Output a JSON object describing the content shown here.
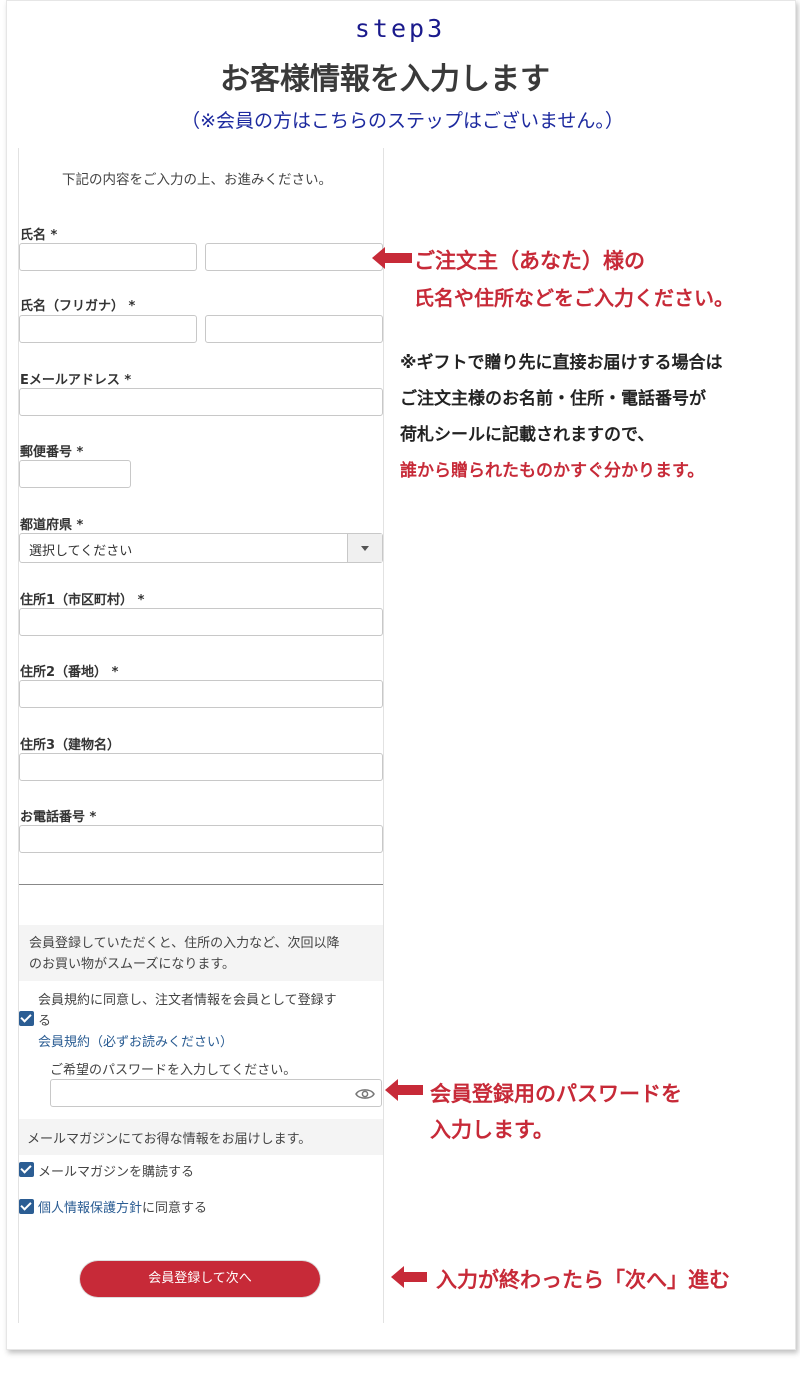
{
  "header": {
    "step": "step3",
    "title": "お客様情報を入力します",
    "subtitle": "（※会員の方はこちらのステップはございません。）"
  },
  "form": {
    "intro": "下記の内容をご入力の上、お進みください。",
    "name_label": "氏名 *",
    "kana_label": "氏名（フリガナ） *",
    "email_label": "Eメールアドレス *",
    "zip_label": "郵便番号 *",
    "pref_label": "都道府県 *",
    "pref_value": "選択してください",
    "addr1_label": "住所1（市区町村） *",
    "addr2_label": "住所2（番地） *",
    "addr3_label": "住所3（建物名）",
    "tel_label": "お電話番号 *",
    "member_note_line1": "会員登録していただくと、住所の入力など、次回以降",
    "member_note_line2": "のお買い物がスムーズになります。",
    "member_agree_line1": "会員規約に同意し、注文者情報を会員として登録す",
    "member_agree_line2": "る",
    "member_terms_link": "会員規約（必ずお読みください）",
    "password_label": "ご希望のパスワードを入力してください。",
    "mailmag_note": "メールマガジンにてお得な情報をお届けします。",
    "mailmag_subscribe": "メールマガジンを購読する",
    "privacy_link": "個人情報保護方針",
    "privacy_suffix": "に同意する",
    "submit_label": "会員登録して次へ",
    "checkbox_member_checked": true,
    "checkbox_mailmag_checked": true,
    "checkbox_privacy_checked": true
  },
  "annotations": {
    "name_line1": "ご注文主（あなた）様の",
    "name_line2": "氏名や住所などをご入力ください。",
    "gift_line1": "※ギフトで贈り先に直接お届けする場合は",
    "gift_line2": "ご注文主様のお名前・住所・電話番号が",
    "gift_line3": "荷札シールに記載されますので、",
    "gift_line4": "誰から贈られたものかすぐ分かります。",
    "password_line1": "会員登録用のパスワードを",
    "password_line2": "入力します。",
    "next_line": "入力が終わったら「次へ」進む"
  },
  "colors": {
    "accent_red": "#c72a38",
    "step_blue": "#1a1a8c",
    "link_blue": "#2b5d93"
  }
}
